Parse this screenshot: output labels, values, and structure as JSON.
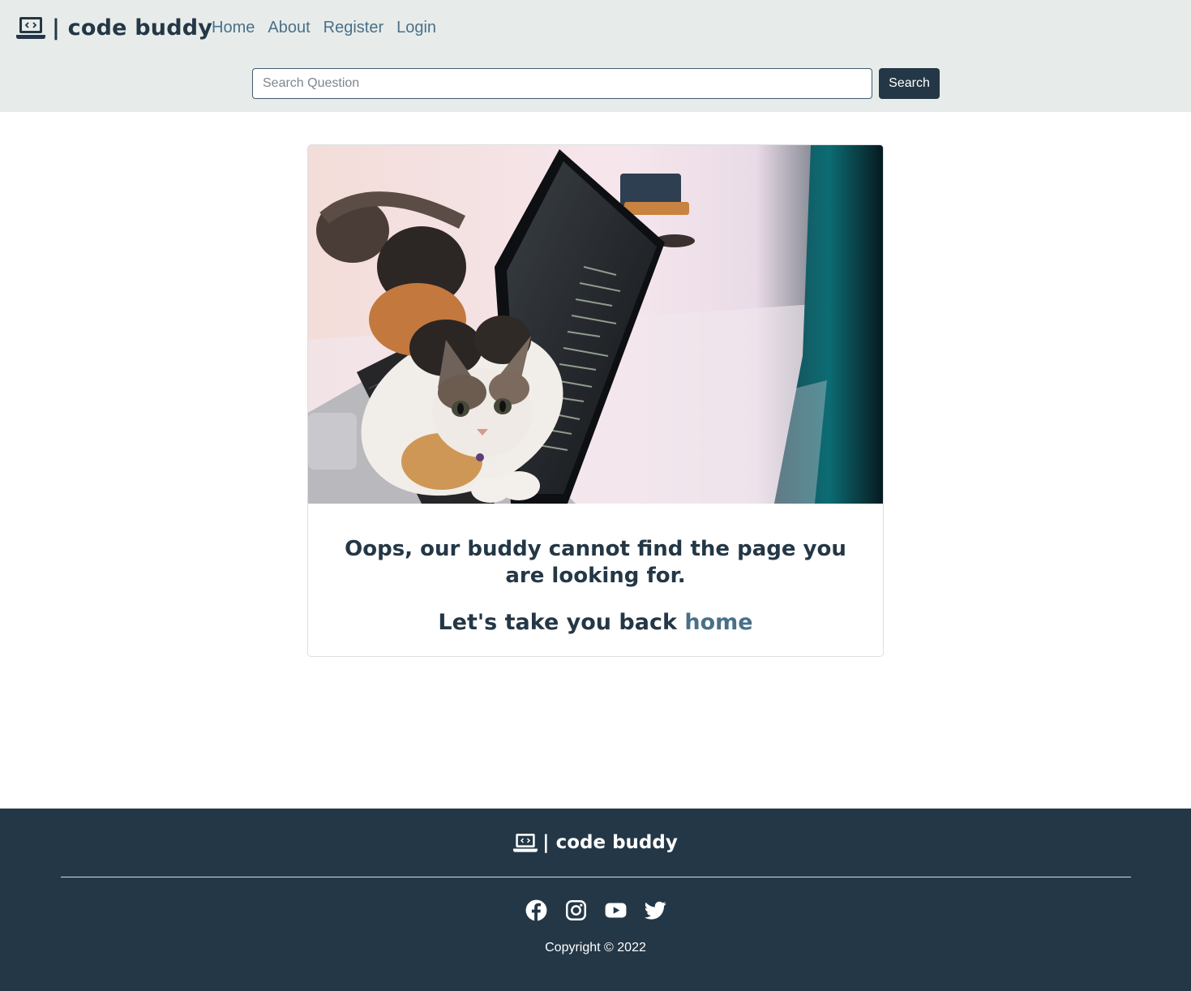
{
  "header": {
    "brand": {
      "icon": "laptop-code-icon",
      "text": "| code buddy"
    },
    "nav": [
      {
        "label": "Home"
      },
      {
        "label": "About"
      },
      {
        "label": "Register"
      },
      {
        "label": "Login"
      }
    ],
    "search": {
      "placeholder": "Search Question",
      "value": "",
      "button_label": "Search"
    }
  },
  "not_found": {
    "image": "cat-on-laptop-photo",
    "message": "Oops, our buddy cannot find the page you are looking for.",
    "back_prefix": "Let's take you back ",
    "back_link": "home"
  },
  "footer": {
    "brand": {
      "icon": "laptop-code-icon",
      "text": "| code buddy"
    },
    "social": [
      "facebook-icon",
      "instagram-icon",
      "youtube-icon",
      "twitter-icon"
    ],
    "copyright": "Copyright © 2022"
  },
  "colors": {
    "header_bg": "#e7ecea",
    "primary": "#243746",
    "link": "#4a7089",
    "footer_bg": "#243746"
  }
}
